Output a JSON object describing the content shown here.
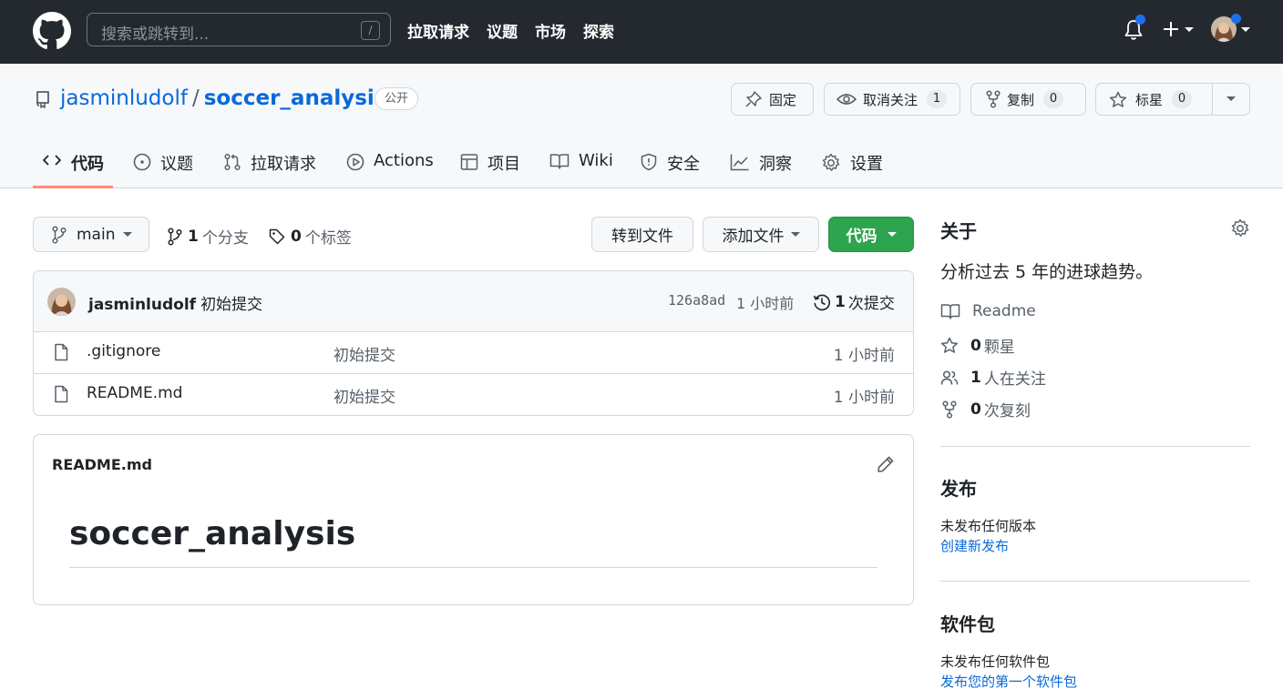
{
  "topbar": {
    "search_placeholder": "搜索或跳转到...",
    "search_shortcut": "/",
    "nav": [
      "拉取请求",
      "议题",
      "市场",
      "探索"
    ]
  },
  "repo": {
    "owner": "jasminludolf",
    "separator": "/",
    "name": "soccer_analysis",
    "visibility": "公开",
    "actions": {
      "pin_label": "固定",
      "unwatch_label": "取消关注",
      "watch_count": "1",
      "fork_label": "复制",
      "fork_count": "0",
      "star_label": "标星",
      "star_count": "0"
    },
    "tabs": [
      "代码",
      "议题",
      "拉取请求",
      "Actions",
      "项目",
      "Wiki",
      "安全",
      "洞察",
      "设置"
    ]
  },
  "toolbar": {
    "branch": "main",
    "branches_count": "1",
    "branches_label": "个分支",
    "tags_count": "0",
    "tags_label": "个标签",
    "goto_file": "转到文件",
    "add_file": "添加文件",
    "code": "代码"
  },
  "commit": {
    "author": "jasminludolf",
    "message": "初始提交",
    "hash": "126a8ad",
    "time": "1 小时前",
    "count": "1",
    "count_label": "次提交"
  },
  "files": [
    {
      "name": ".gitignore",
      "message": "初始提交",
      "time": "1 小时前"
    },
    {
      "name": "README.md",
      "message": "初始提交",
      "time": "1 小时前"
    }
  ],
  "readme": {
    "title": "README.md",
    "heading": "soccer_analysis"
  },
  "sidebar": {
    "about_heading": "关于",
    "description": "分析过去 5 年的进球趋势。",
    "readme_label": "Readme",
    "stars_count": "0",
    "stars_label": "颗星",
    "watchers_count": "1",
    "watchers_label": "人在关注",
    "forks_count": "0",
    "forks_label": "次复刻",
    "releases_heading": "发布",
    "releases_text": "未发布任何版本",
    "releases_link": "创建新发布",
    "packages_heading": "软件包",
    "packages_text": "未发布任何软件包",
    "packages_link": "发布您的第一个软件包"
  }
}
